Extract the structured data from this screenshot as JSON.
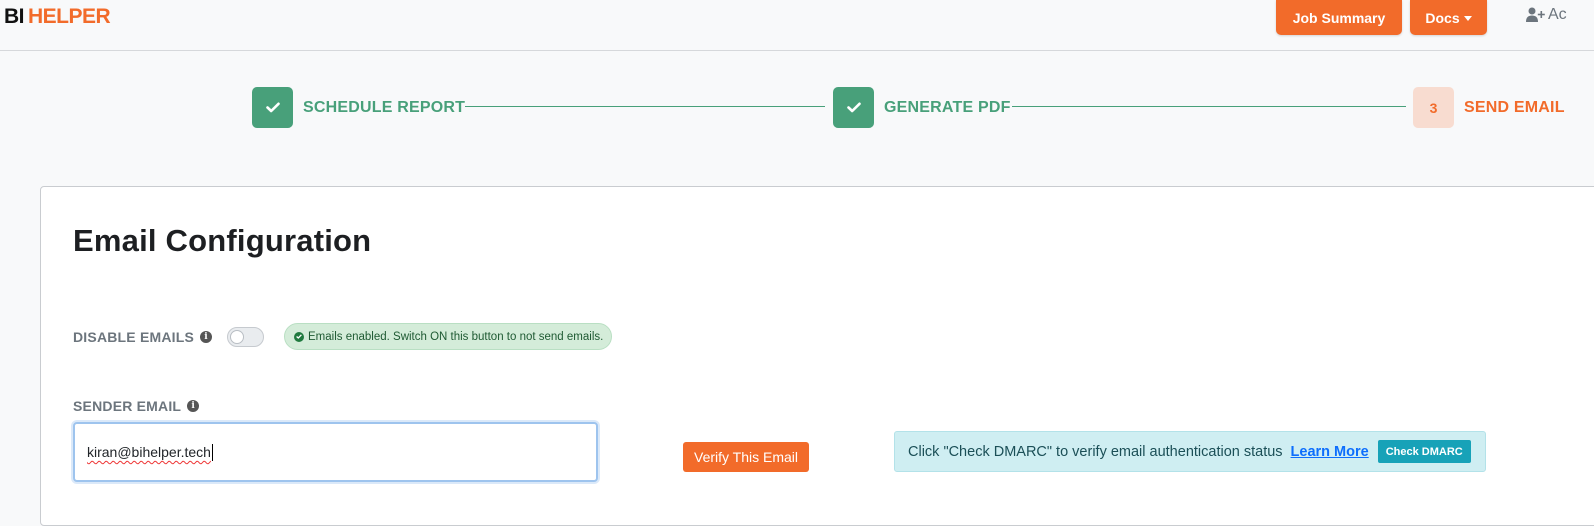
{
  "brand": {
    "part1": "BI",
    "part2": "HELPER"
  },
  "nav": {
    "job_summary": "Job Summary",
    "docs": "Docs",
    "add_user_text": "Ac"
  },
  "stepper": {
    "steps": [
      {
        "label": "SCHEDULE REPORT",
        "state": "done"
      },
      {
        "label": "GENERATE PDF",
        "state": "done"
      },
      {
        "label": "SEND EMAIL",
        "state": "current",
        "number": "3"
      }
    ]
  },
  "card": {
    "title": "Email Configuration",
    "disable_emails": {
      "label": "DISABLE EMAILS",
      "toggle_on": false,
      "status": "Emails enabled. Switch ON this button to not send emails."
    },
    "sender_email": {
      "label": "SENDER EMAIL",
      "value": "kiran@bihelper.tech"
    },
    "verify_button": "Verify This Email",
    "dmarc": {
      "message": "Click \"Check DMARC\" to verify email authentication status",
      "learn_more": "Learn More",
      "check_button": "Check DMARC"
    }
  },
  "colors": {
    "brand_orange": "#f26b2a",
    "step_done_green": "#48a07a",
    "info_teal": "#17a2b8"
  }
}
